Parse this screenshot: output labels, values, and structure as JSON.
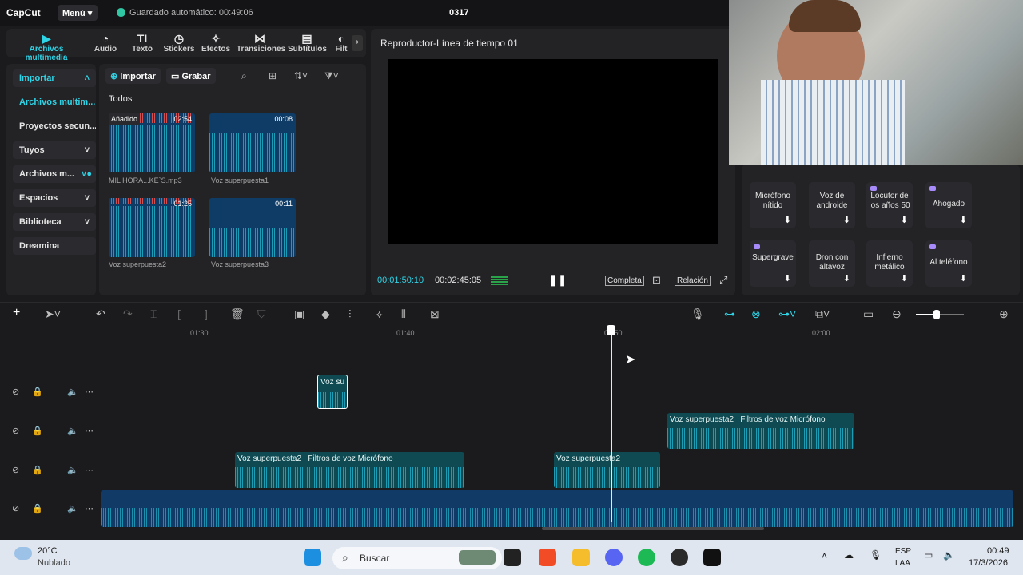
{
  "app": {
    "logo": "CapCut",
    "menu": "Menú",
    "autosave": "Guardado automático: 00:49:06",
    "project_title": "0317"
  },
  "tabs": [
    {
      "label": "Archivos multimedia",
      "icon": "media-icon"
    },
    {
      "label": "Audio",
      "icon": "audio-icon"
    },
    {
      "label": "Texto",
      "icon": "text-icon"
    },
    {
      "label": "Stickers",
      "icon": "sticker-icon"
    },
    {
      "label": "Efectos",
      "icon": "effects-icon"
    },
    {
      "label": "Transiciones",
      "icon": "transition-icon"
    },
    {
      "label": "Subtítulos",
      "icon": "subtitle-icon"
    },
    {
      "label": "Filt",
      "icon": "filter-icon"
    }
  ],
  "leftnav": [
    {
      "label": "Importar"
    },
    {
      "label": "Archivos multim..."
    },
    {
      "label": "Proyectos secun..."
    },
    {
      "label": "Tuyos"
    },
    {
      "label": "Archivos m..."
    },
    {
      "label": "Espacios"
    },
    {
      "label": "Biblioteca"
    },
    {
      "label": "Dreamina"
    }
  ],
  "media": {
    "import_btn": "Importar",
    "record_btn": "Grabar",
    "section": "Todos",
    "items": [
      {
        "name": "MIL HORA...KE`S.mp3",
        "duration": "02:54",
        "tag": "Añadido"
      },
      {
        "name": "Voz superpuesta1",
        "duration": "00:08"
      },
      {
        "name": "Voz superpuesta2",
        "duration": "01:25"
      },
      {
        "name": "Voz superpuesta3",
        "duration": "00:11"
      }
    ]
  },
  "player": {
    "title": "Reproductor-Línea de tiempo 01",
    "current": "00:01:50:10",
    "total": "00:02:45:05",
    "complete": "Completa",
    "ratio": "Relación"
  },
  "voices": [
    {
      "label": "Micrófono nítido"
    },
    {
      "label": "Voz de androide"
    },
    {
      "label": "Locutor de los años 50"
    },
    {
      "label": "Ahogado"
    },
    {
      "label": "Supergrave"
    },
    {
      "label": "Dron con altavoz"
    },
    {
      "label": "Infierno metálico"
    },
    {
      "label": "Al teléfono"
    }
  ],
  "ruler": [
    "01:30",
    "01:40",
    "01:50",
    "02:00"
  ],
  "clips": {
    "c1": "Voz su",
    "c2a": "Voz superpuesta2",
    "c2b": "Filtros de voz Micrófono",
    "c3a": "Voz superpuesta2",
    "c3b": "Filtros de voz Micrófono",
    "c4": "Voz superpuesta2"
  },
  "taskbar": {
    "temp": "20°C",
    "weather": "Nublado",
    "search": "Buscar",
    "lang1": "ESP",
    "lang2": "LAA",
    "time": "00:49",
    "date": "17/3/2026"
  }
}
